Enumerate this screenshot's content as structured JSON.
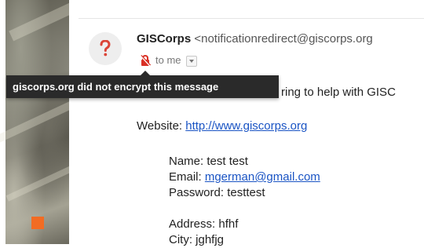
{
  "sender": {
    "name": "GISCorps",
    "email": "<notificationredirect@giscorps.org"
  },
  "recipient": {
    "label": "to me"
  },
  "tooltip": {
    "text": "giscorps.org did not encrypt this message"
  },
  "message": {
    "intro_fragment": "ring to help with GISC",
    "website_label": "Website: ",
    "website_url": "http://www.giscorps.org",
    "name_line": "Name: test test",
    "email_label": "Email: ",
    "email_value": "mgerman@gmail.com",
    "password_line": "Password: testtest",
    "address_line": "Address: hfhf",
    "city_line": "City: jghfjg"
  },
  "colors": {
    "accent_orange": "#f26c23",
    "avatar_question": "#db4437",
    "link": "#1a54c4",
    "tooltip_bg": "#2a2a2a",
    "lock_red": "#d93025"
  },
  "icons": {
    "avatar": "question-mark-icon",
    "encryption": "unencrypted-lock-icon",
    "dropdown": "chevron-down-icon"
  }
}
